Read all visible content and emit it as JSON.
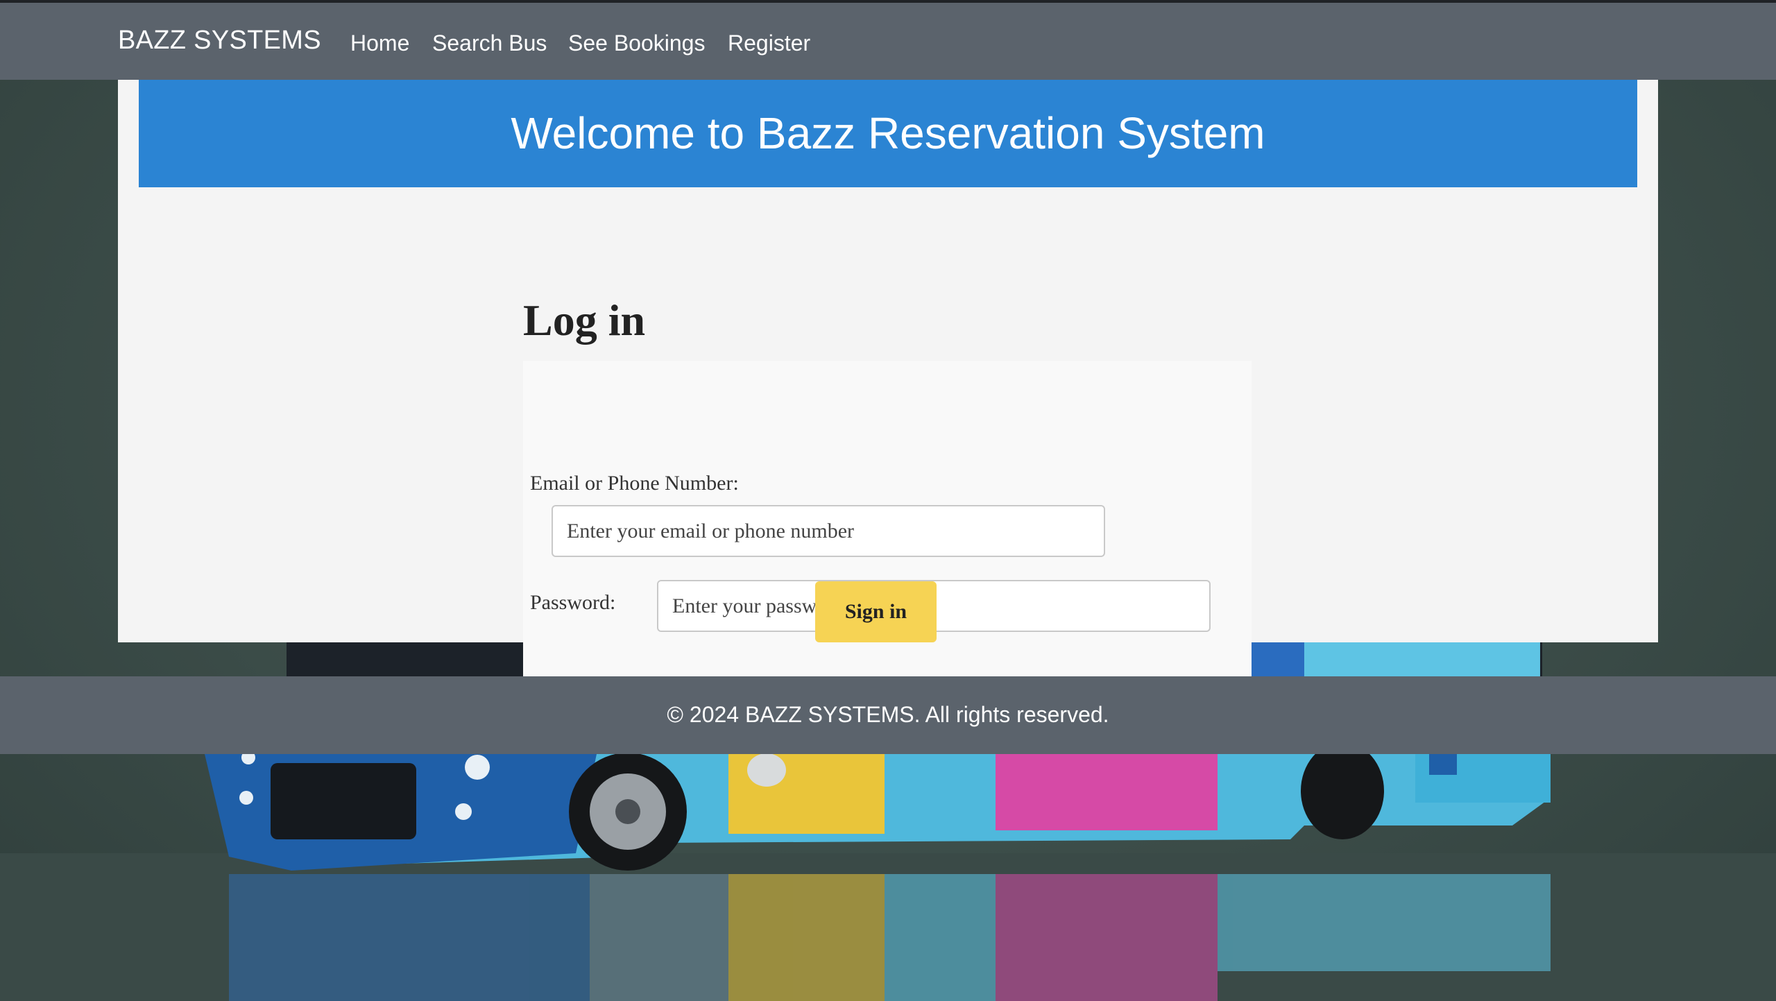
{
  "navbar": {
    "brand": "BAZZ SYSTEMS",
    "links": [
      {
        "label": "Home"
      },
      {
        "label": "Search Bus"
      },
      {
        "label": "See Bookings"
      },
      {
        "label": "Register"
      }
    ]
  },
  "banner": {
    "title": "Welcome to Bazz Reservation System"
  },
  "login": {
    "heading": "Log in",
    "email_label": "Email or Phone Number:",
    "email_placeholder": "Enter your email or phone number",
    "email_value": "",
    "password_label": "Password:",
    "password_placeholder": "Enter your password",
    "password_value": "",
    "submit_label": "Sign in"
  },
  "footer": {
    "text": "© 2024 BAZZ SYSTEMS. All rights reserved."
  },
  "colors": {
    "navbar_bg": "#5b636c",
    "banner_bg": "#2b84d3",
    "card_bg": "#f4f4f4",
    "button_bg": "#f6d354",
    "page_bg": "#3f504c"
  }
}
